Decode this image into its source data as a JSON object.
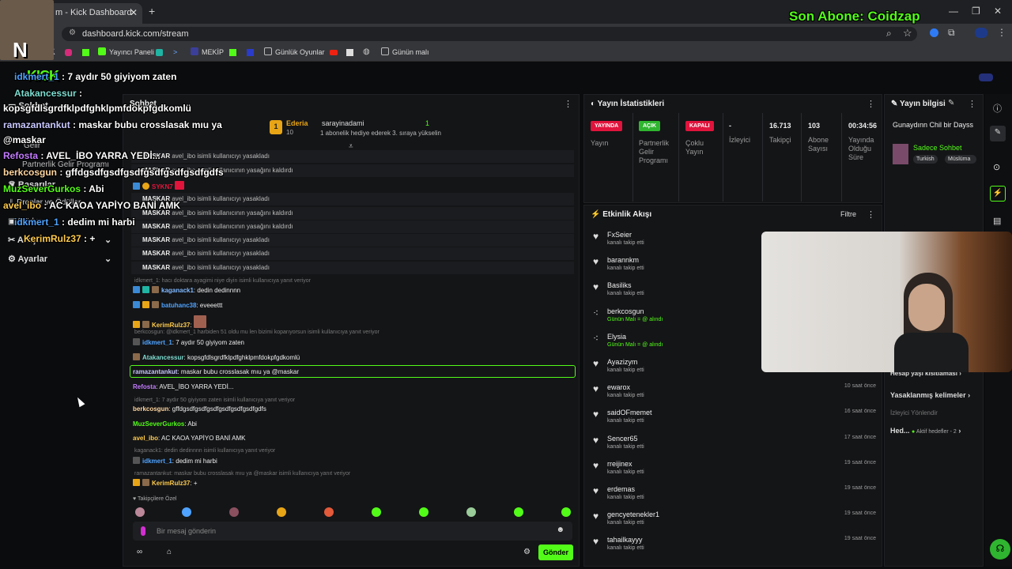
{
  "browser": {
    "tab_title": "m - Kick Dashboard",
    "url": "dashboard.kick.com/stream",
    "bookmarks": [
      "Yayıncı Paneli",
      "MEKİP",
      "Günlük Oyunlar",
      "Günün malı"
    ]
  },
  "overlay": {
    "last_sub": "Son Abone: Coidzap",
    "chat": [
      {
        "user": "idkmert_1",
        "text": "7 aydır 50 giyiyom zaten",
        "color": "#4fa3ff"
      },
      {
        "user": "Atakancessur",
        "text": "",
        "color": "#7ddcd0"
      },
      {
        "user": "",
        "text": "kopsgfdlsgrdfklpdfghklpmfdokpfgdkomlü",
        "color": "#fff"
      },
      {
        "user": "ramazantankut",
        "text": "maskar bubu crosslasak mıu ya",
        "color": "#c8c8ff"
      },
      {
        "user": "",
        "text": "@maskar",
        "color": "#fff"
      },
      {
        "user": "Refosta",
        "text": "AVEL_İBO YARRA YEDİ...",
        "color": "#c37bff"
      },
      {
        "user": "berkcosgun",
        "text": "gffdgsdfgsdfgsdfgsdfgsdfgsdfgdfs",
        "color": "#ffd6a0"
      },
      {
        "user": "MuzSeverGurkos",
        "text": "Abi",
        "color": "#53fc18"
      },
      {
        "user": "avel_ibo",
        "text": "AC KAOA YAPİYO BANİ AMK",
        "color": "#ffcc4d"
      },
      {
        "user": "idkmert_1",
        "text": "dedim mi harbi",
        "color": "#4fa3ff"
      },
      {
        "user": "KerimRulz37",
        "text": "+",
        "color": "#ffcc4d"
      }
    ]
  },
  "sidebar": {
    "items": [
      "Sohbet",
      "Gelir",
      "Partnerlik Gelir Programı",
      "Başarılar",
      "Droplar ve Ödüller",
      "Stüdyo",
      "Araçlar",
      "Ayarlar"
    ]
  },
  "chat": {
    "title": "Sohbet",
    "pinned": {
      "rank": "1",
      "user": "Ederia",
      "count": "10",
      "target": "sarayinadami",
      "goal": "1",
      "msg": "1 abonelik hediye ederek 3. sıraya yükselin"
    },
    "mod_rows": [
      {
        "who": "MASKAR",
        "t": "avel_ibo isimli kullanıcıyı yasakladı"
      },
      {
        "who": "MASKAR",
        "t": "avel_ibo isimli kullanıcının yasağını kaldırdı"
      },
      {
        "who": "MASKAR",
        "t": "avel_ibo isimli kullanıcıyı yasakladı"
      },
      {
        "who": "MASKAR",
        "t": "avel_ibo isimli kullanıcının yasağını kaldırdı"
      },
      {
        "who": "MASKAR",
        "t": "avel_ibo isimli kullanıcının yasağını kaldırdı"
      },
      {
        "who": "MASKAR",
        "t": "avel_ibo isimli kullanıcıyı yasakladı"
      },
      {
        "who": "MASKAR",
        "t": "avel_ibo isimli kullanıcıyı yasakladı"
      },
      {
        "who": "MASKAR",
        "t": "avel_ibo isimli kullanıcıyı yasakladı"
      }
    ],
    "syk": "SYKN7",
    "reply1": "idkmert_1: hacı doktara ayagimi niye diyin isimli kullanıcıya yanıt veriyor",
    "m1": {
      "user": "kaganack1",
      "text": "dedin dedinnnn"
    },
    "m2": {
      "user": "batuhanc38",
      "text": "eveeettt"
    },
    "m3": {
      "user": "KerimRulz37",
      "text": ""
    },
    "reply2": "berkcosgun: @idkmert_1 harbiden 51 oldu mu len bizimi koparıyorsun isimli kullanıcıya yanıt veriyor",
    "m4": {
      "user": "idkmert_1",
      "text": "7 aydır 50 giyiyom zaten"
    },
    "m5": {
      "user": "Atakancessur",
      "text": "kopsgfdlsgrdfklpdfghklpmfdokpfgdkomlü"
    },
    "m6": {
      "user": "ramazantankut",
      "text": "maskar bubu crosslasak mıu ya @maskar"
    },
    "m7": {
      "user": "Refosta",
      "text": "AVEL_İBO YARRA YEDİ..."
    },
    "reply3": "idkmert_1: 7 aydır 50 giyiyom zaten isimli kullanıcıya yanıt veriyor",
    "m8": {
      "user": "berkcosgun",
      "text": "gffdgsdfgsdfgsdfgsdfgsdfgsdfgdfs"
    },
    "m9": {
      "user": "MuzSeverGurkos",
      "text": "Abi"
    },
    "m10": {
      "user": "avel_ibo",
      "text": "AC KAOA YAPİYO BANİ AMK"
    },
    "reply4": "kaganack1: dedin dedinnnn isimli kullanıcıya yanıt veriyor",
    "m11": {
      "user": "idkmert_1",
      "text": "dedim mi harbi"
    },
    "reply5": "ramazantankut: maskar bubu crosslasak mıu ya @maskar isimli kullanıcıya yanıt veriyor",
    "m12": {
      "user": "KerimRulz37",
      "text": "+"
    },
    "followers_only": "Takipçilere Özel",
    "input_placeholder": "Bir mesaj gönderin",
    "send": "Gönder"
  },
  "stats": {
    "title": "Yayın İstatistikleri",
    "cells": [
      {
        "badge": "YAYINDA",
        "badge_color": "#e0143c",
        "label": "Yayın"
      },
      {
        "badge": "AÇIK",
        "badge_color": "#2fb52f",
        "label": "Partnerlik Gelir Programı"
      },
      {
        "badge": "KAPALI",
        "badge_color": "#e0143c",
        "label": "Çoklu Yayın"
      },
      {
        "value": "-",
        "label": "İzleyici"
      },
      {
        "value": "16.713",
        "label": "Takipçi"
      },
      {
        "value": "103",
        "label": "Abone Sayısı"
      },
      {
        "value": "00:34:56",
        "label": "Yayında Olduğu Süre"
      }
    ]
  },
  "info": {
    "title": "Yayın bilgisi",
    "stream_title": "Gunaydınn Chil bir Dayss",
    "category": "Sadece Sohbet",
    "tags": [
      "Turkish",
      "Müslüma"
    ],
    "links": [
      "Hesap yaşı kısıtlaması",
      "Yasaklanmış kelimeler",
      "İzleyici Yönlendir",
      "Hed...",
      "Aktif hedefler - 2"
    ]
  },
  "events": {
    "title": "Etkinlik Akışı",
    "filter": "Filtre",
    "items": [
      {
        "icon": "heart",
        "name": "FxSeier",
        "sub": "kanalı takip etti",
        "time": ""
      },
      {
        "icon": "heart",
        "name": "barannkm",
        "sub": "kanalı takip etti",
        "time": ""
      },
      {
        "icon": "heart",
        "name": "Basiliks",
        "sub": "kanalı takip etti",
        "time": ""
      },
      {
        "icon": "dots",
        "name": "berkcosgun",
        "sub": "Günün Malı = @ alındı",
        "time": ""
      },
      {
        "icon": "dots",
        "name": "Elysia",
        "sub": "Günün Malı = @ alındı",
        "time": ""
      },
      {
        "icon": "heart",
        "name": "Ayazizym",
        "sub": "kanalı takip etti",
        "time": ""
      },
      {
        "icon": "heart",
        "name": "ewarox",
        "sub": "kanalı takip etti",
        "time": "10 saat önce"
      },
      {
        "icon": "heart",
        "name": "saidOFmemet",
        "sub": "kanalı takip etti",
        "time": "16 saat önce"
      },
      {
        "icon": "heart",
        "name": "Sencer65",
        "sub": "kanalı takip etti",
        "time": "17 saat önce"
      },
      {
        "icon": "heart",
        "name": "rreijinex",
        "sub": "kanalı takip etti",
        "time": "19 saat önce"
      },
      {
        "icon": "heart",
        "name": "erdemas",
        "sub": "kanalı takip etti",
        "time": "19 saat önce"
      },
      {
        "icon": "heart",
        "name": "gencyetenekler1",
        "sub": "kanalı takip etti",
        "time": "19 saat önce"
      },
      {
        "icon": "heart",
        "name": "tahailkayyy",
        "sub": "kanalı takip etti",
        "time": "19 saat önce"
      }
    ]
  }
}
